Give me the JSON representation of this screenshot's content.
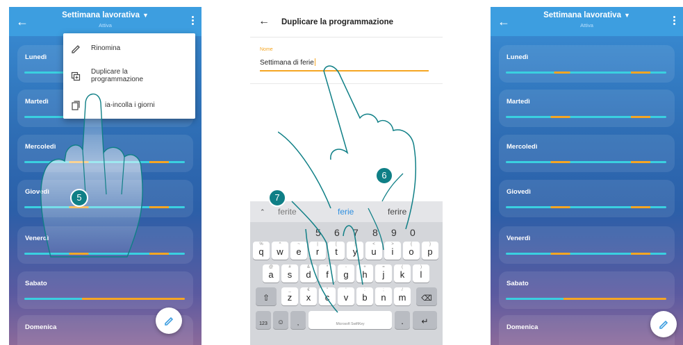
{
  "left_phone": {
    "title": "Settimana lavorativa",
    "subtitle": "Attiva",
    "days": [
      "Lunedì",
      "Martedì",
      "Mercoledì",
      "Giovedì",
      "Venerdì",
      "Sabato",
      "Domenica"
    ],
    "menu": {
      "items": [
        {
          "label": "Rinomina",
          "icon": "pencil-icon"
        },
        {
          "label": "Duplicare la programmazione",
          "icon": "duplicate-icon"
        },
        {
          "label": "ia-incolla i giorni",
          "icon": "copy-icon"
        }
      ]
    },
    "step_badge": "5"
  },
  "middle_phone": {
    "title": "Duplicare la programmazione",
    "field_label": "Nome",
    "field_value": "Settimana di ferie",
    "suggestions": [
      "ferite",
      "ferie",
      "ferire"
    ],
    "number_row": [
      "5",
      "6",
      "7",
      "8",
      "9",
      "0"
    ],
    "row1": [
      "q",
      "w",
      "e",
      "r",
      "t",
      "y",
      "u",
      "i",
      "o",
      "p"
    ],
    "row1_hints": [
      "%",
      "^",
      "~",
      "|",
      "[",
      "]",
      "<",
      ">",
      "{",
      "}"
    ],
    "row2": [
      "a",
      "s",
      "d",
      "f",
      "g",
      "h",
      "j",
      "k",
      "l"
    ],
    "row2_hints": [
      "@",
      "#",
      "&",
      "*",
      "-",
      "+",
      "=",
      "(",
      ")"
    ],
    "row3": [
      "z",
      "x",
      "c",
      "v",
      "b",
      "n",
      "m"
    ],
    "row3_hints": [
      "_",
      "€",
      "\"",
      "'",
      ":",
      ";",
      "/"
    ],
    "bottom": {
      "num_key": "123",
      "space_label": "Microsoft SwiftKey"
    },
    "step_badges": [
      "6",
      "7"
    ]
  },
  "right_phone": {
    "title": "Settimana lavorativa",
    "subtitle": "Attiva",
    "days": [
      "Lunedì",
      "Martedì",
      "Mercoledì",
      "Giovedì",
      "Venerdì",
      "Sabato",
      "Domenica"
    ]
  },
  "colors": {
    "appbar": "#3d9ee0",
    "bar_cyan": "#3ad0e0",
    "bar_orange": "#f5a623",
    "accent": "#f5a623",
    "badge": "#0f7f86"
  }
}
